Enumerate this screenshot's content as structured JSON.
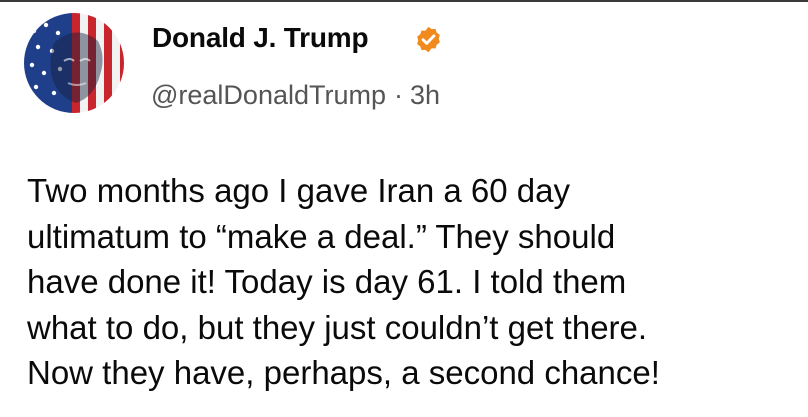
{
  "post": {
    "display_name": "Donald J. Trump",
    "handle": "@realDonaldTrump",
    "separator": "·",
    "timestamp": "3h",
    "body_lines": [
      "Two months ago I gave Iran a 60 day",
      "ultimatum to “make a deal.” They should",
      "have done it! Today is day 61. I told them",
      "what to do, but they just couldn’t get there.",
      "Now they have, perhaps, a second chance!"
    ]
  },
  "icons": {
    "avatar": "profile-avatar-flag",
    "verified": "verified-badge-icon"
  },
  "colors": {
    "verified_badge": "#f08a1c",
    "handle_text": "#555555",
    "body_text": "#0a0a0a"
  }
}
